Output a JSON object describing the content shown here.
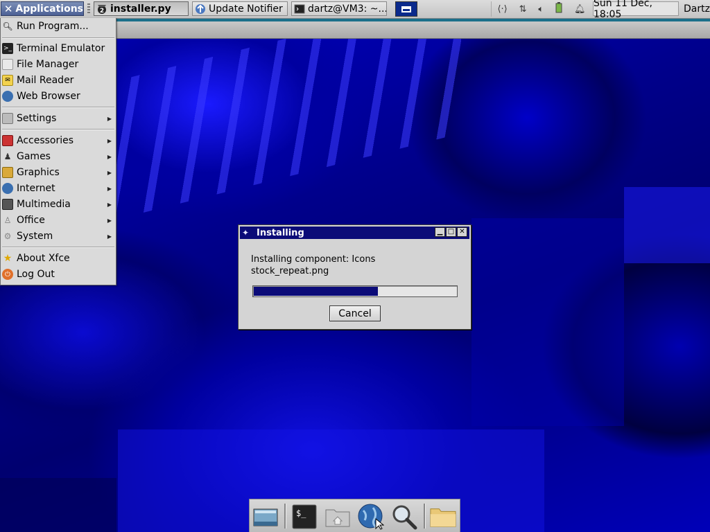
{
  "top_panel": {
    "applications_label": "Applications",
    "tasks": [
      {
        "label": "installer.py",
        "active": true
      },
      {
        "label": "Update Notifier",
        "active": false
      },
      {
        "label": "dartz@VM3: ~...",
        "active": false
      }
    ],
    "clock": "Sun 11 Dec, 18:05",
    "user": "Dartz"
  },
  "menu": {
    "run_program": "Run Program...",
    "favorites": [
      "Terminal Emulator",
      "File Manager",
      "Mail Reader",
      "Web Browser"
    ],
    "settings": "Settings",
    "categories": [
      "Accessories",
      "Games",
      "Graphics",
      "Internet",
      "Multimedia",
      "Office",
      "System"
    ],
    "about": "About Xfce",
    "logout": "Log Out"
  },
  "dialog": {
    "title": "Installing",
    "line1": "Installing component: Icons",
    "line2": "stock_repeat.png",
    "progress": 0.61,
    "cancel_label": "Cancel"
  },
  "dock": {
    "icons": [
      "show-desktop-icon",
      "terminal-icon",
      "home-folder-icon",
      "web-browser-icon",
      "search-icon",
      "folder-icon"
    ]
  },
  "colors": {
    "title_bar": "#0b0b78",
    "progress_fill": "#0b0b78",
    "desktop_base": "#0000a0",
    "panel": "#d4d4d4"
  }
}
